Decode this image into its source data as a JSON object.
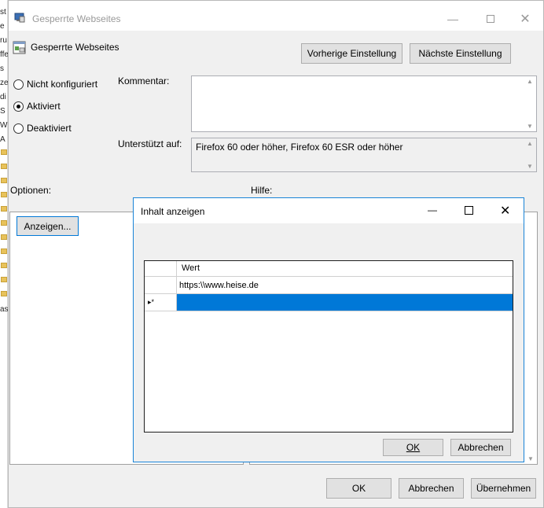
{
  "background_window": {
    "left_edge_chars": [
      "st",
      "e",
      "ru",
      "ffe",
      "s",
      "ze",
      "di",
      "S",
      "W",
      "A",
      "as"
    ]
  },
  "main_window": {
    "title": "Gesperrte Webseites",
    "policy_name": "Gesperrte Webseites",
    "prev_button": "Vorherige Einstellung",
    "next_button": "Nächste Einstellung",
    "radios": [
      {
        "label": "Nicht konfiguriert",
        "checked": false
      },
      {
        "label": "Aktiviert",
        "checked": true
      },
      {
        "label": "Deaktiviert",
        "checked": false
      }
    ],
    "comment_label": "Kommentar:",
    "supported_label": "Unterstützt auf:",
    "supported_value": "Firefox 60 oder höher, Firefox 60 ESR oder höher",
    "options_label": "Optionen:",
    "help_label": "Hilfe:",
    "show_button": "Anzeigen...",
    "ok_button": "OK",
    "cancel_button": "Abbrechen",
    "apply_button": "Übernehmen"
  },
  "dialog": {
    "title": "Inhalt anzeigen",
    "column_header": "Wert",
    "rows": [
      "https:\\\\www.heise.de",
      ""
    ],
    "new_row_marker": "▸*",
    "ok_button": "OK",
    "cancel_button": "Abbrechen"
  },
  "colors": {
    "accent": "#0078d7",
    "window_bg": "#f0f0f0"
  }
}
